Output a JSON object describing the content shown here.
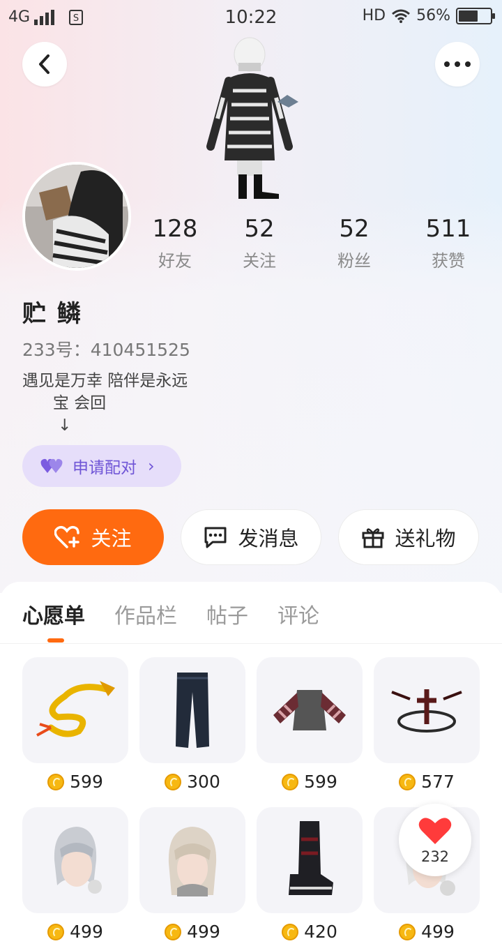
{
  "status_bar": {
    "network": "4G",
    "time": "10:22",
    "hd": "HD",
    "battery": "56%"
  },
  "header": {
    "back_icon": "chevron-left-icon",
    "more_icon": "more-horizontal-icon"
  },
  "profile": {
    "stats": [
      {
        "value": "128",
        "label": "好友"
      },
      {
        "value": "52",
        "label": "关注"
      },
      {
        "value": "52",
        "label": "粉丝"
      },
      {
        "value": "511",
        "label": "获赞"
      }
    ],
    "name": "贮 鳞",
    "uid": "233号：410451525",
    "bio": "遇见是万幸 陪伴是永远\n      宝 会回\n       ↓",
    "pair_button": "申请配对"
  },
  "actions": {
    "follow": "关注",
    "message": "发消息",
    "gift": "送礼物"
  },
  "tabs": [
    "心愿单",
    "作品栏",
    "帖子",
    "评论"
  ],
  "wishlist": [
    {
      "price": "599",
      "icon": "golden-dragon-icon"
    },
    {
      "price": "300",
      "icon": "jeans-icon"
    },
    {
      "price": "599",
      "icon": "striped-sweater-icon"
    },
    {
      "price": "577",
      "icon": "dark-emblem-icon"
    },
    {
      "price": "499",
      "icon": "silver-hair-icon"
    },
    {
      "price": "499",
      "icon": "blonde-hair-icon"
    },
    {
      "price": "420",
      "icon": "black-boots-icon"
    },
    {
      "price": "499",
      "icon": "white-hair-icon"
    }
  ],
  "like_float": {
    "count": "232"
  },
  "colors": {
    "accent": "#ff6a10",
    "pair_bg": "#e6defa",
    "pair_text": "#6f55d6"
  }
}
